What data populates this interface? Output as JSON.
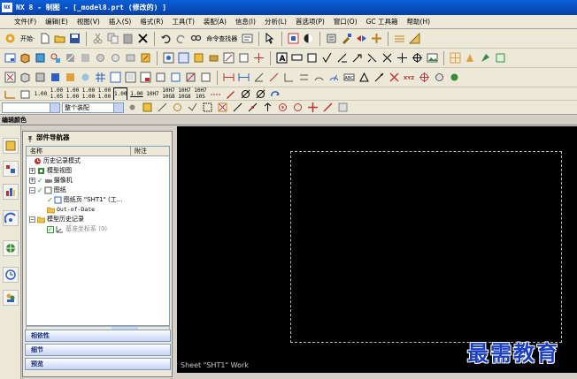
{
  "window": {
    "title": "NX 8 - 制图 - [_model8.prt (修改的) ]",
    "logo_text": "NX"
  },
  "menu": [
    "文件(F)",
    "编辑(E)",
    "视图(V)",
    "插入(S)",
    "格式(R)",
    "工具(T)",
    "装配(A)",
    "信息(I)",
    "分析(L)",
    "首选项(P)",
    "窗口(O)",
    "GC 工具箱",
    "帮助(H)"
  ],
  "toolbar1": {
    "start_label": "开始·",
    "command_finder_label": "命令查找器"
  },
  "toolbar3_numbers": [
    {
      "top": "1.00",
      "bottom": ""
    },
    {
      "top": "1.00",
      "bottom": "1.05"
    },
    {
      "top": "1.00",
      "bottom": "1.00"
    },
    {
      "top": "1.00",
      "bottom": "1.00"
    },
    {
      "top": "1.00",
      "bottom": "1.00"
    },
    {
      "top": "1.00",
      "bottom": ""
    },
    {
      "top": "1.00",
      "bottom": ""
    },
    {
      "top": "10H7",
      "bottom": ""
    },
    {
      "top": "10H7",
      "bottom": "10G8"
    },
    {
      "top": "10H7",
      "bottom": "10G8"
    },
    {
      "top": "10H7",
      "bottom": "10S"
    }
  ],
  "selectbar": {
    "filter_value": "",
    "scope_value": "整个装配"
  },
  "edit_label": "编辑颜色",
  "navigator": {
    "title": "部件导航器",
    "col_name": "名称",
    "col_attach": "附注",
    "rows": [
      {
        "label": "历史记录模式",
        "indent": 0,
        "expander": "",
        "check": false,
        "grey": false
      },
      {
        "label": "模型视图",
        "indent": 0,
        "expander": "+",
        "check": false,
        "grey": false
      },
      {
        "label": "摄像机",
        "indent": 0,
        "expander": "+",
        "check": true,
        "grey": false
      },
      {
        "label": "图纸",
        "indent": 0,
        "expander": "−",
        "check": true,
        "grey": false
      },
      {
        "label": "图纸页 \"SHT1\" (工...",
        "indent": 1,
        "expander": "",
        "check": true,
        "grey": false
      },
      {
        "label": "Out-of-Date",
        "indent": 1,
        "expander": "",
        "check": false,
        "grey": false
      },
      {
        "label": "模型历史记录",
        "indent": 0,
        "expander": "−",
        "check": false,
        "grey": false
      },
      {
        "label": "基准坐标系 (0)",
        "indent": 1,
        "expander": "",
        "check": true,
        "grey": true
      }
    ],
    "panels": [
      "相依性",
      "细节",
      "预览"
    ]
  },
  "graphics": {
    "sheet_label": "Sheet \"SHT1\" Work"
  },
  "watermark": "最需教育"
}
